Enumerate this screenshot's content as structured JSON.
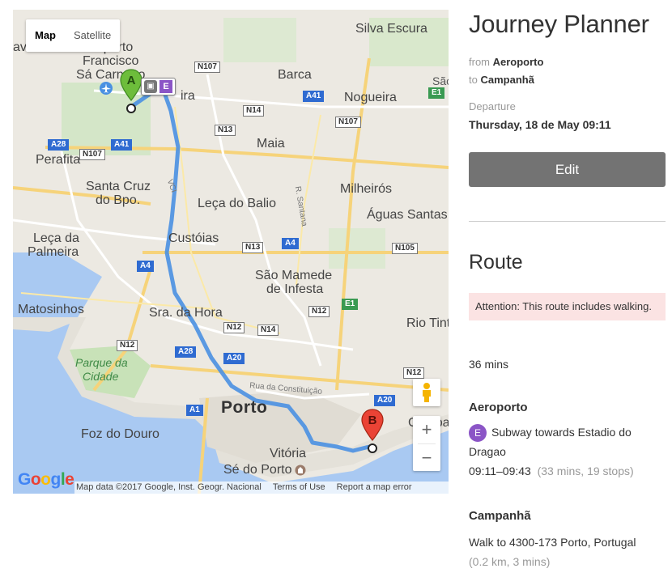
{
  "map": {
    "type_buttons": {
      "map": "Map",
      "satellite": "Satellite"
    },
    "labels": {
      "aeroporto": [
        "Aeroporto",
        "Francisco",
        "Sá Carneiro"
      ],
      "silva_escura": "Silva Escura",
      "barca": "Barca",
      "nogueira": "Nogueira",
      "sao": "São",
      "maia": "Maia",
      "perafita": "Perafita",
      "santa_cruz": [
        "Santa Cruz",
        "do Bpo."
      ],
      "leca_balio": "Leça do Balio",
      "milheiros": "Milheirós",
      "aguas_santas": "Águas Santas",
      "custoias": "Custóias",
      "leca_palmeira": [
        "Leça da",
        "Palmeira"
      ],
      "sao_mamede": [
        "São Mamede",
        "de Infesta"
      ],
      "matosinhos": "Matosinhos",
      "sra_hora": "Sra. da Hora",
      "rio_tinto": "Rio Tint",
      "parque": [
        "Parque da",
        "Cidade"
      ],
      "porto": "Porto",
      "foz": "Foz do Douro",
      "vitoria": "Vitória",
      "se": "Sé do Porto",
      "campanha_partial": "Campa",
      "rua_constituicao": "Rua da Constituição",
      "r_santana": "R. Santana",
      "lavra": "avra",
      "ira": "ira",
      "vci": "VCI"
    },
    "shields": {
      "n107a": "N107",
      "n14a": "N14",
      "n13a": "N13",
      "n107b": "N107",
      "a41a": "A41",
      "e1a": "E1",
      "a28a": "A28",
      "n107c": "N107",
      "a41b": "A41",
      "n13b": "N13",
      "a4a": "A4",
      "n105": "N105",
      "a4b": "A4",
      "e1b": "E1",
      "n12a": "N12",
      "n12b": "N12",
      "n14b": "N14",
      "n12c": "N12",
      "a28b": "A28",
      "a20a": "A20",
      "n12d": "N12",
      "a20b": "A20",
      "a1": "A1"
    },
    "marker_a": "A",
    "marker_b": "B",
    "transit_line": "E",
    "google": "Google",
    "attribution": {
      "data": "Map data ©2017 Google, Inst. Geogr. Nacional",
      "terms": "Terms of Use",
      "report": "Report a map error"
    },
    "zoom_in": "+",
    "zoom_out": "−",
    "route_color": "#4a90e2"
  },
  "sidebar": {
    "title": "Journey Planner",
    "from_label": "from",
    "from_value": "Aeroporto",
    "to_label": "to",
    "to_value": "Campanhã",
    "departure_label": "Departure",
    "departure_value": "Thursday, 18 de May 09:11",
    "edit_button": "Edit",
    "route_heading": "Route",
    "alert": "Attention: This route includes walking.",
    "duration": "36 mins",
    "steps": [
      {
        "stop": "Aeroporto",
        "line_badge": "E",
        "line_color": "#8b55c6",
        "description": "Subway towards Estadio do Dragao",
        "time": "09:11–09:43",
        "detail": "(33 mins, 19 stops)"
      },
      {
        "stop": "Campanhã",
        "description": "Walk to 4300-173 Porto, Portugal",
        "detail": "(0.2 km, 3 mins)"
      }
    ]
  }
}
